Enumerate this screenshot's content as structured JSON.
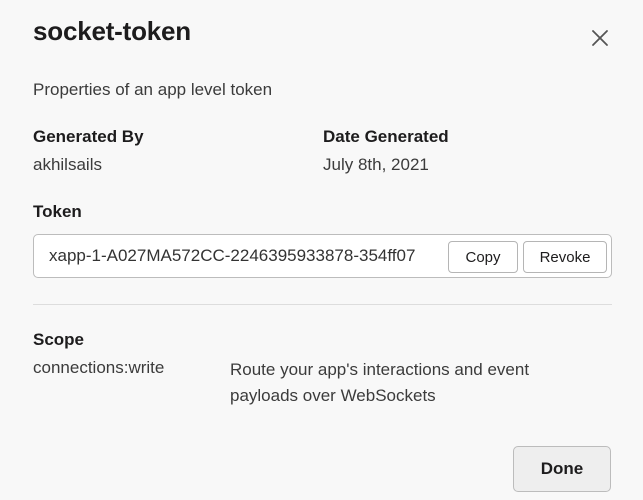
{
  "modal": {
    "title": "socket-token",
    "subtitle": "Properties of an app level token",
    "close_icon": "close-icon"
  },
  "meta": {
    "generated_by_label": "Generated By",
    "generated_by_value": "akhilsails",
    "date_label": "Date Generated",
    "date_value": "July 8th, 2021"
  },
  "token": {
    "label": "Token",
    "value": "xapp-1-A027MA572CC-2246395933878-354ff07",
    "copy_label": "Copy",
    "revoke_label": "Revoke"
  },
  "scope": {
    "label": "Scope",
    "name": "connections:write",
    "description": "Route your app's interactions and event payloads over WebSockets"
  },
  "footer": {
    "done_label": "Done"
  }
}
